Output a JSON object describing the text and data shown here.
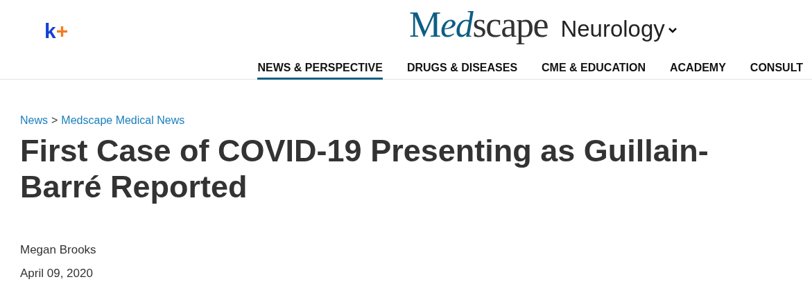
{
  "header": {
    "badge": {
      "letter": "k",
      "sign": "+"
    },
    "logo": {
      "initial": "M",
      "italic": "ed",
      "rest": "scape"
    },
    "section": "Neurology"
  },
  "nav": [
    {
      "label": "NEWS & PERSPECTIVE",
      "selected": true
    },
    {
      "label": "DRUGS & DISEASES",
      "selected": false
    },
    {
      "label": "CME & EDUCATION",
      "selected": false
    },
    {
      "label": "ACADEMY",
      "selected": false
    },
    {
      "label": "CONSULT",
      "selected": false
    }
  ],
  "breadcrumb": {
    "items": [
      "News",
      "Medscape Medical News"
    ],
    "separator": ">"
  },
  "article": {
    "title": "First Case of COVID-19 Presenting as Guillain-Barré Reported",
    "author": "Megan Brooks",
    "date": "April 09, 2020"
  }
}
